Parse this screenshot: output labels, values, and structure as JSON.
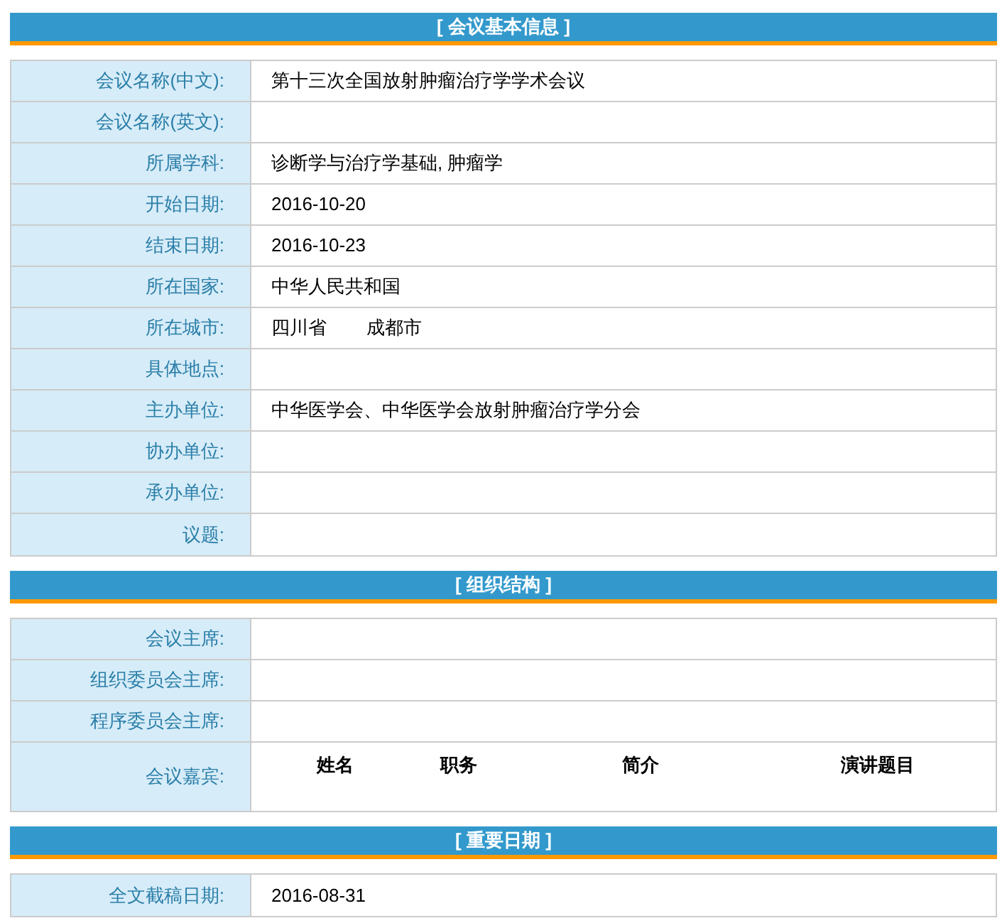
{
  "sections": [
    {
      "title": "[ 会议基本信息 ]",
      "rows": [
        {
          "kind": "text",
          "label": "会议名称(中文):",
          "values": [
            "第十三次全国放射肿瘤治疗学学术会议"
          ]
        },
        {
          "kind": "text",
          "label": "会议名称(英文):"
        },
        {
          "kind": "text",
          "label": "所属学科:",
          "values": [
            "诊断学与治疗学基础, 肿瘤学"
          ]
        },
        {
          "kind": "text",
          "label": "开始日期:",
          "values": [
            "2016-10-20"
          ]
        },
        {
          "kind": "text",
          "label": "结束日期:",
          "values": [
            "2016-10-23"
          ]
        },
        {
          "kind": "text",
          "label": "所在国家:",
          "values": [
            "中华人民共和国"
          ]
        },
        {
          "kind": "text",
          "label": "所在城市:",
          "values": [
            "四川省",
            "成都市"
          ]
        },
        {
          "kind": "text",
          "label": "具体地点:"
        },
        {
          "kind": "text",
          "label": "主办单位:",
          "values": [
            "中华医学会、中华医学会放射肿瘤治疗学分会"
          ]
        },
        {
          "kind": "text",
          "label": "协办单位:"
        },
        {
          "kind": "text",
          "label": "承办单位:"
        },
        {
          "kind": "text",
          "label": "议题:"
        }
      ]
    },
    {
      "title": "[ 组织结构 ]",
      "rows": [
        {
          "kind": "text",
          "label": "会议主席:"
        },
        {
          "kind": "text",
          "label": "组织委员会主席:"
        },
        {
          "kind": "text",
          "label": "程序委员会主席:"
        },
        {
          "kind": "guests",
          "label": "会议嘉宾:",
          "columns": [
            "姓名",
            "职务",
            "简介",
            "演讲题目"
          ]
        }
      ]
    },
    {
      "title": "[ 重要日期 ]",
      "rows": [
        {
          "kind": "text",
          "label": "全文截稿日期:",
          "values": [
            "2016-08-31"
          ]
        }
      ]
    }
  ]
}
